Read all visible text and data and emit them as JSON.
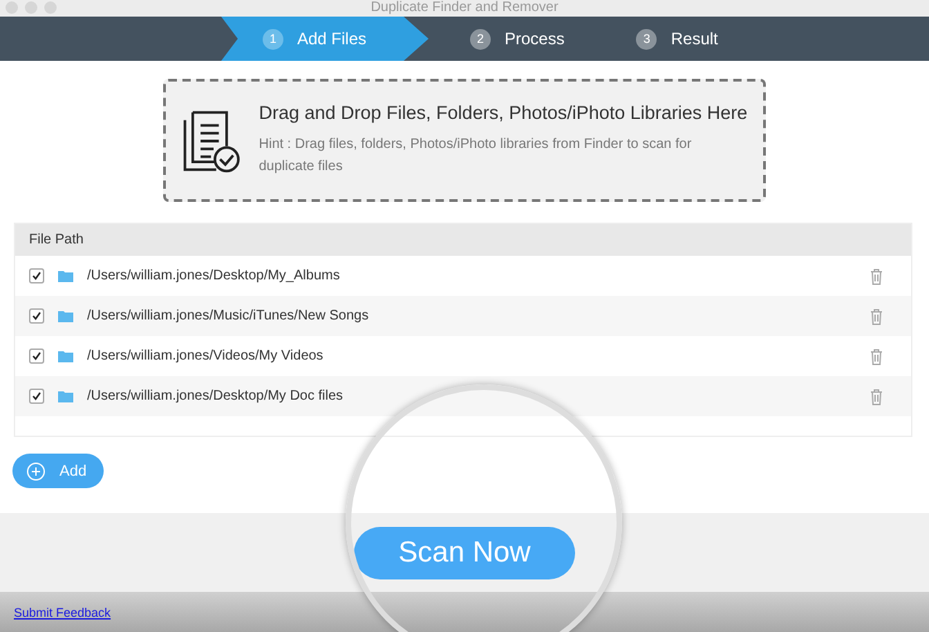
{
  "window": {
    "title": "Duplicate Finder and Remover"
  },
  "steps": [
    {
      "number": "1",
      "label": "Add Files",
      "selected": true
    },
    {
      "number": "2",
      "label": "Process",
      "selected": false
    },
    {
      "number": "3",
      "label": "Result",
      "selected": false
    }
  ],
  "drop_zone": {
    "title": "Drag and Drop Files, Folders, Photos/iPhoto Libraries Here",
    "hint": "Hint : Drag files, folders, Photos/iPhoto libraries from Finder to scan for duplicate files"
  },
  "table": {
    "columns": [
      "File Path"
    ],
    "rows": [
      {
        "path": "/Users/william.jones/Desktop/My_Albums",
        "checked": true
      },
      {
        "path": "/Users/william.jones/Music/iTunes/New Songs",
        "checked": true
      },
      {
        "path": "/Users/william.jones/Videos/My Videos",
        "checked": true
      },
      {
        "path": "/Users/william.jones/Desktop/My Doc files",
        "checked": true
      }
    ]
  },
  "add_button": "Add",
  "scan_button": "Scan Now",
  "feedback_link": "Submit Feedback"
}
